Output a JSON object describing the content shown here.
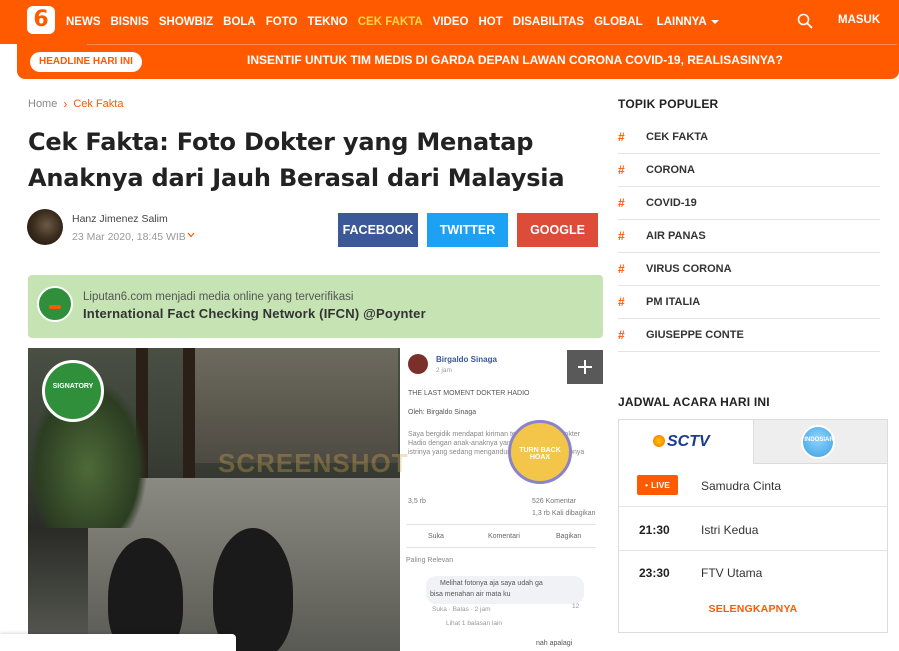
{
  "header": {
    "logo_text": "6",
    "nav": [
      "NEWS",
      "BISNIS",
      "SHOWBIZ",
      "BOLA",
      "FOTO",
      "TEKNO",
      "CEK FAKTA",
      "VIDEO",
      "HOT",
      "DISABILITAS",
      "GLOBAL"
    ],
    "nav_active": "CEK FAKTA",
    "more_label": "LAINNYA",
    "login_label": "MASUK",
    "accent_color": "#ff5a00"
  },
  "headline": {
    "pill": "HEADLINE HARI INI",
    "text": "INSENTIF UNTUK TIM MEDIS DI GARDA DEPAN LAWAN CORONA COVID-19, REALISASINYA?"
  },
  "breadcrumb": {
    "home": "Home",
    "current": "Cek Fakta"
  },
  "article": {
    "title": "Cek Fakta: Foto Dokter yang Menatap Anaknya dari Jauh Berasal dari Malaysia",
    "author": "Hanz Jimenez Salim",
    "date": "23 Mar 2020, 18:45 WIB"
  },
  "share": {
    "facebook": "FACEBOOK",
    "twitter": "TWITTER",
    "google": "GOOGLE"
  },
  "ifcn": {
    "line1": "Liputan6.com menjadi media online yang terverifikasi",
    "line2": "International Fact Checking Network (IFCN) @Poynter"
  },
  "image": {
    "seal_text": "SIGNATORY",
    "watermark": "SCREENSHOT",
    "hoax_seal_text": "TURN BACK HOAX",
    "fb": {
      "name": "Birgaldo Sinaga",
      "time": "2 jam",
      "post_title": "THE LAST MOMENT DOKTER HADIO",
      "post_by": "Oleh: Birgaldo Sinaga",
      "post_body": "Saya bergidik mendapat kiriman tentang terakhir dokter Hadio dengan anak-anaknya yang masih kecil dan istrinya yang sedang mengandung... Lihat Selengkapnya",
      "reactions": "3,5 rb",
      "comments": "526 Komentar",
      "shares": "1,3 rb Kali dibagikan",
      "like": "Suka",
      "comment": "Komentari",
      "share": "Bagikan",
      "sort": "Paling Relevan",
      "comment1_line1": "Melihat fotonya aja saya udah ga",
      "comment1_line2": "bisa menahan air mata ku",
      "comment1_meta": "Suka · Balas · 2 jam",
      "comment1_react": "12",
      "replies": "Lihat 1 balasan lain",
      "comment2": "nah apalagi"
    }
  },
  "sidebar": {
    "topics_title": "TOPIK POPULER",
    "topics": [
      "CEK FAKTA",
      "CORONA",
      "COVID-19",
      "AIR PANAS",
      "VIRUS CORONA",
      "PM ITALIA",
      "GIUSEPPE CONTE"
    ],
    "schedule_title": "JADWAL ACARA HARI INI",
    "channel_1": "SCTV",
    "channel_2": "INDOSIAR",
    "live_label": "LIVE",
    "schedule": [
      {
        "time": "",
        "show": "Samudra Cinta",
        "live": true
      },
      {
        "time": "21:30",
        "show": "Istri Kedua",
        "live": false
      },
      {
        "time": "23:30",
        "show": "FTV Utama",
        "live": false
      }
    ],
    "see_more": "SELENGKAPNYA"
  }
}
